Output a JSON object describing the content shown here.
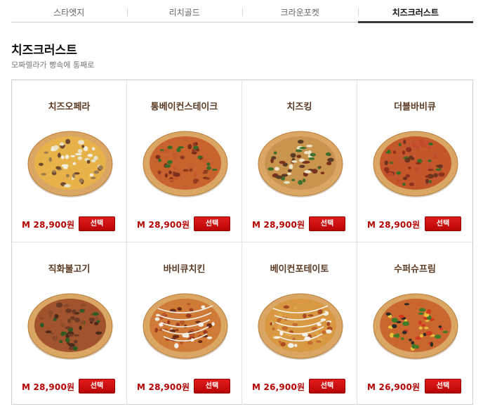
{
  "tabs": [
    {
      "label": "스타엣지",
      "active": false
    },
    {
      "label": "리치골드",
      "active": false
    },
    {
      "label": "크라운포켓",
      "active": false
    },
    {
      "label": "치즈크러스트",
      "active": true
    }
  ],
  "section": {
    "title": "치즈크러스트",
    "subtitle": "모짜렐라가 빵속에 통째로"
  },
  "colors": {
    "price": "#b40000",
    "button": "#d40f0f",
    "product_name": "#5b3a22"
  },
  "products": [
    {
      "name": "치즈오페라",
      "price": "M  28,900원",
      "button": "선택",
      "icon": "pizza-image"
    },
    {
      "name": "통베이컨스테이크",
      "price": "M  28,900원",
      "button": "선택",
      "icon": "pizza-image"
    },
    {
      "name": "치즈킹",
      "price": "M  28,900원",
      "button": "선택",
      "icon": "pizza-image"
    },
    {
      "name": "더블바비큐",
      "price": "M  28,900원",
      "button": "선택",
      "icon": "pizza-image"
    },
    {
      "name": "직화불고기",
      "price": "M  28,900원",
      "button": "선택",
      "icon": "pizza-image"
    },
    {
      "name": "바비큐치킨",
      "price": "M  28,900원",
      "button": "선택",
      "icon": "pizza-image"
    },
    {
      "name": "베이컨포테이토",
      "price": "M  26,900원",
      "button": "선택",
      "icon": "pizza-image"
    },
    {
      "name": "수퍼슈프림",
      "price": "M  26,900원",
      "button": "선택",
      "icon": "pizza-image"
    }
  ]
}
